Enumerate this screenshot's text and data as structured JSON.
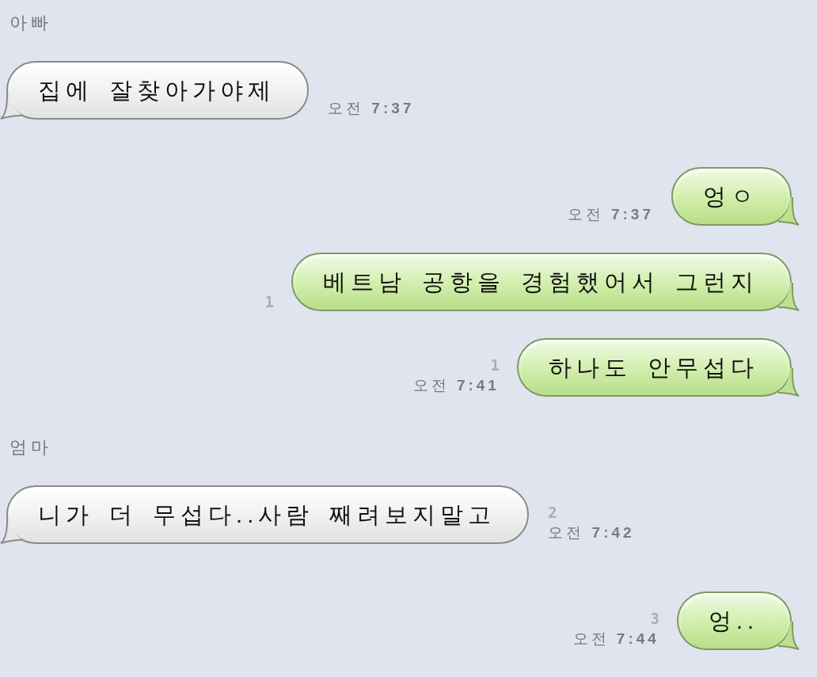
{
  "messages": [
    {
      "kind": "received",
      "sender": "아빠",
      "text": "집에 잘찾아가야제",
      "time": "오전 **7:37**"
    },
    {
      "kind": "sent",
      "text": "엉ㅇ",
      "time": "오전 **7:37**"
    },
    {
      "kind": "sent",
      "text": "베트남 공항을 경험했어서 그런지",
      "unread": "1"
    },
    {
      "kind": "sent",
      "text": "하나도 안무섭다",
      "unread": "1",
      "time": "오전 **7:41**"
    },
    {
      "kind": "received",
      "sender": "엄마",
      "text": "니가 더 무섭다..사람 째려보지말고",
      "unread": "2",
      "time": "오전 **7:42**"
    },
    {
      "kind": "sent",
      "text": "엉..",
      "unread": "3",
      "time": "오전 **7:44**"
    }
  ]
}
